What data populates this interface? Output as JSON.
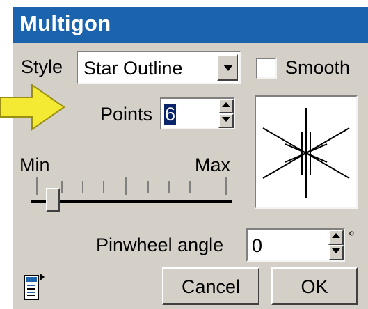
{
  "window": {
    "title": "Multigon"
  },
  "style": {
    "label": "Style",
    "value": "Star Outline"
  },
  "smooth": {
    "label": "Smooth",
    "checked": false
  },
  "points": {
    "label": "Points",
    "value": "6"
  },
  "slider": {
    "min_label": "Min",
    "max_label": "Max"
  },
  "pinwheel": {
    "label": "Pinwheel angle",
    "value": "0",
    "unit": "°"
  },
  "buttons": {
    "cancel": "Cancel",
    "ok": "OK"
  },
  "icons": {
    "arrow": "yellow-arrow-icon",
    "menu": "dialog-menu-icon",
    "preview": "star-preview-icon"
  },
  "colors": {
    "titlebar": "#1c63ae",
    "dialog": "#d4d0c8",
    "arrow": "#f4ea34"
  }
}
